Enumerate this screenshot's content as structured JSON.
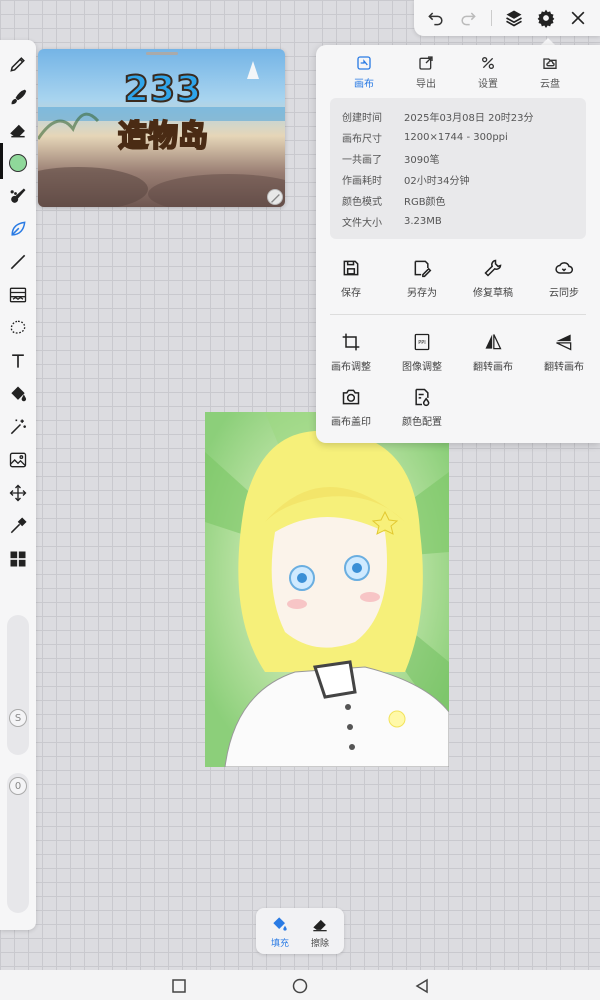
{
  "reference_image": {
    "line1": "233",
    "line2": "造物岛"
  },
  "toolbar": {
    "undo_icon": "undo-icon",
    "redo_icon": "redo-icon",
    "layers_icon": "layers-icon",
    "settings_icon": "gear-icon",
    "close_icon": "close-icon"
  },
  "panel": {
    "tabs": [
      {
        "label": "画布",
        "icon": "canvas-icon",
        "active": true
      },
      {
        "label": "导出",
        "icon": "export-icon",
        "active": false
      },
      {
        "label": "设置",
        "icon": "settings-tools-icon",
        "active": false
      },
      {
        "label": "云盘",
        "icon": "cloud-drive-icon",
        "active": false
      }
    ],
    "info": [
      {
        "key": "创建时间",
        "value": "2025年03月08日 20时23分"
      },
      {
        "key": "画布尺寸",
        "value": "1200×1744 - 300ppi"
      },
      {
        "key": "一共画了",
        "value": "3090笔"
      },
      {
        "key": "作画耗时",
        "value": "02小时34分钟"
      },
      {
        "key": "颜色模式",
        "value": "RGB颜色"
      },
      {
        "key": "文件大小",
        "value": "3.23MB"
      }
    ],
    "actions_row1": [
      {
        "label": "保存",
        "icon": "save-icon"
      },
      {
        "label": "另存为",
        "icon": "save-as-icon"
      },
      {
        "label": "修复草稿",
        "icon": "wrench-icon"
      },
      {
        "label": "云同步",
        "icon": "cloud-sync-icon"
      }
    ],
    "actions_row2": [
      {
        "label": "画布调整",
        "icon": "crop-icon"
      },
      {
        "label": "图像调整",
        "icon": "ppi-icon"
      },
      {
        "label": "翻转画布",
        "icon": "flip-horizontal-icon"
      },
      {
        "label": "翻转画布",
        "icon": "flip-vertical-icon"
      }
    ],
    "actions_row3": [
      {
        "label": "画布盖印",
        "icon": "camera-icon"
      },
      {
        "label": "颜色配置",
        "icon": "color-profile-icon"
      }
    ],
    "ppi_glyph": "PPI"
  },
  "left_tools": [
    "pen-icon",
    "brush-icon",
    "eraser-icon",
    "color-swatch",
    "smudge-icon",
    "leaf-brush-icon",
    "line-icon",
    "filter-icon",
    "lasso-icon",
    "text-icon",
    "fill-bucket-icon",
    "magic-wand-icon",
    "image-import-icon",
    "transform-icon",
    "eyedropper-icon",
    "grid-icon"
  ],
  "sliders": {
    "size_label": "S",
    "opacity_label": "0"
  },
  "mini_toolbar": {
    "fill_label": "填充",
    "erase_label": "擦除"
  },
  "colors": {
    "accent": "#2a7be4",
    "current_color": "#8fd89a"
  }
}
